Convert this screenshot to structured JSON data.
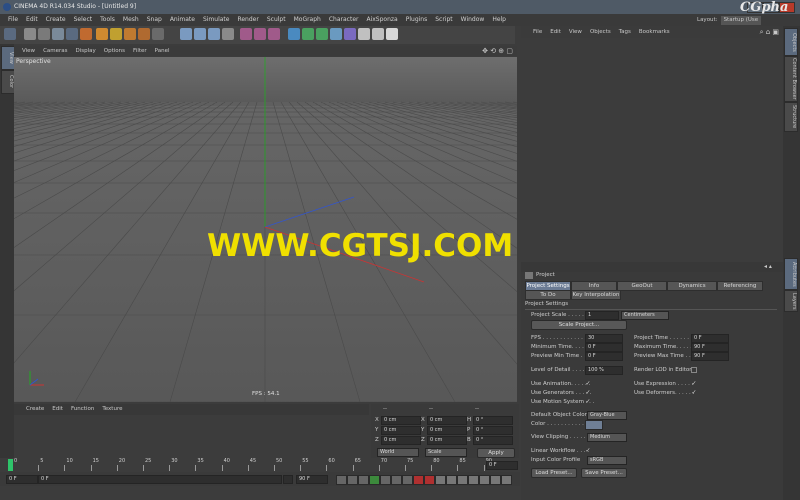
{
  "window": {
    "title": "CINEMA 4D R14.034 Studio - [Untitled 9]"
  },
  "menubar": [
    "File",
    "Edit",
    "Create",
    "Select",
    "Tools",
    "Mesh",
    "Snap",
    "Animate",
    "Simulate",
    "Render",
    "Sculpt",
    "MoGraph",
    "Character",
    "AixSponza",
    "Plugins",
    "Script",
    "Window",
    "Help"
  ],
  "layout": {
    "label": "Layout:",
    "value": "Startup (Use"
  },
  "viewport": {
    "menu": [
      "View",
      "Cameras",
      "Display",
      "Options",
      "Filter",
      "Panel"
    ],
    "name": "Perspective",
    "fps": "FPS : 54.1"
  },
  "object_manager": {
    "menu": [
      "File",
      "Edit",
      "View",
      "Objects",
      "Tags",
      "Bookmarks"
    ]
  },
  "right_tabs": [
    "Objects",
    "Content Browser",
    "Structure"
  ],
  "right_tabs_lower": [
    "Attributes",
    "Layers"
  ],
  "left_tabs": [
    "View",
    "Color"
  ],
  "attributes": {
    "title": "Project",
    "section": "Project Settings",
    "tabs_row1": [
      "Project Settings",
      "Info",
      "GeoOut",
      "Dynamics",
      "Referencing"
    ],
    "tabs_row2": [
      "To Do",
      "Key Interpolation"
    ],
    "project_scale_label": "Project Scale . . . . . .",
    "project_scale_value": "1",
    "project_scale_unit": "Centimeters",
    "scale_project_btn": "Scale Project...",
    "fps_label": "FPS . . . . . . . . . . . .",
    "fps_value": "30",
    "project_time_label": "Project Time . . . . . .",
    "project_time_value": "0 F",
    "min_time_label": "Minimum Time. . . . . .",
    "min_time_value": "0 F",
    "max_time_label": "Maximum Time. . . . . .",
    "max_time_value": "90 F",
    "prev_min_label": "Preview Min Time . . .",
    "prev_min_value": "0 F",
    "prev_max_label": "Preview Max Time . . .",
    "prev_max_value": "90 F",
    "lod_label": "Level of Detail . . . . .",
    "lod_value": "100 %",
    "render_lod_label": "Render LOD in Editor",
    "use_anim_label": "Use Animation. . . . . .",
    "use_expr_label": "Use Expression . . . . .",
    "use_gen_label": "Use Generators . . . . .",
    "use_deform_label": "Use Deformers. . . . . .",
    "use_motion_label": "Use Motion System . . .",
    "def_color_label": "Default Object Color",
    "def_color_value": "Gray-Blue",
    "color_label": "Color . . . . . . . . . . . .",
    "view_clip_label": "View Clipping . . . . .",
    "view_clip_value": "Medium",
    "linear_label": "Linear Workflow . . . .",
    "icp_label": "Input Color Profile",
    "icp_value": "sRGB",
    "load_preset": "Load Preset...",
    "save_preset": "Save Preset...",
    "check": "✓"
  },
  "material_manager": {
    "menu": [
      "Create",
      "Edit",
      "Function",
      "Texture"
    ]
  },
  "coordinates": {
    "col_headers": [
      "--",
      "--",
      "--"
    ],
    "rows": [
      {
        "a": "X",
        "av": "0 cm",
        "b": "X",
        "bv": "0 cm",
        "c": "H",
        "cv": "0 °"
      },
      {
        "a": "Y",
        "av": "0 cm",
        "b": "Y",
        "bv": "0 cm",
        "c": "P",
        "cv": "0 °"
      },
      {
        "a": "Z",
        "av": "0 cm",
        "b": "Z",
        "bv": "0 cm",
        "c": "B",
        "cv": "0 °"
      }
    ],
    "mode1": "World",
    "mode2": "Scale",
    "apply": "Apply"
  },
  "timeline": {
    "ticks": [
      "0",
      "5",
      "10",
      "15",
      "20",
      "25",
      "30",
      "35",
      "40",
      "45",
      "50",
      "55",
      "60",
      "65",
      "70",
      "75",
      "80",
      "85",
      "90"
    ],
    "frame_end": "0 F",
    "start": "0 F",
    "start_field": "0 F",
    "end_field": "90 F",
    "end": "90 F"
  },
  "watermark": "WWW.CGTSJ.COM",
  "logo_text": "CGpha",
  "colors": {
    "accent_tab": "#6b7b94",
    "watermark": "#f0e000",
    "y_axis": "#22aa22",
    "x_axis": "#cc3333",
    "z_axis": "#3355cc"
  }
}
